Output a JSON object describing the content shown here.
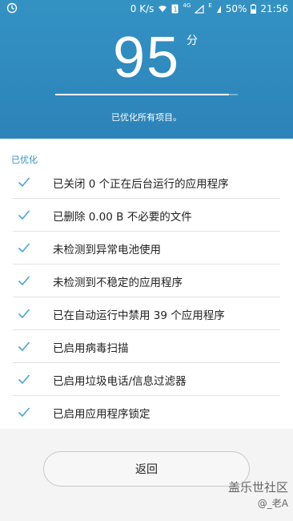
{
  "status_bar": {
    "speed": "0 K/s",
    "network": "4G",
    "network2": "E",
    "battery": "50%",
    "time": "21:56"
  },
  "header": {
    "score": "95",
    "unit": "分",
    "progress": 0.95,
    "summary": "已优化所有项目。"
  },
  "section_title": "已优化",
  "items": [
    {
      "label": "已关闭 0 个正在后台运行的应用程序"
    },
    {
      "label": "已删除 0.00 B 不必要的文件"
    },
    {
      "label": "未检测到异常电池使用"
    },
    {
      "label": "未检测到不稳定的应用程序"
    },
    {
      "label": "已在自动运行中禁用 39 个应用程序"
    },
    {
      "label": "已启用病毒扫描"
    },
    {
      "label": "已启用垃圾电话/信息过滤器"
    },
    {
      "label": "已启用应用程序锁定"
    }
  ],
  "back_button": "返回",
  "watermark": {
    "line1": "盖乐世社区",
    "line2": "@_老A"
  },
  "colors": {
    "header_blue": "#2f8bc0",
    "accent_blue": "#2f8fc4"
  }
}
